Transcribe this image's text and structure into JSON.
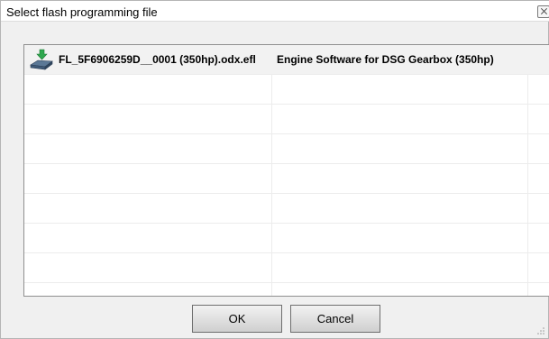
{
  "window": {
    "title": "Select flash programming file"
  },
  "file_list": {
    "rows": [
      {
        "file_name": "FL_5F6906259D__0001 (350hp).odx.efl",
        "description": "Engine Software for DSG Gearbox (350hp)",
        "icon": "module-download-icon"
      }
    ],
    "empty_rows": 7
  },
  "buttons": {
    "ok_label": "OK",
    "cancel_label": "Cancel"
  },
  "colors": {
    "dialog_background": "#f0f0f0",
    "list_background": "#ffffff",
    "selected_row": "#f2f2f2",
    "icon_arrow": "#2fa84f",
    "icon_module": "#3f5a78"
  }
}
